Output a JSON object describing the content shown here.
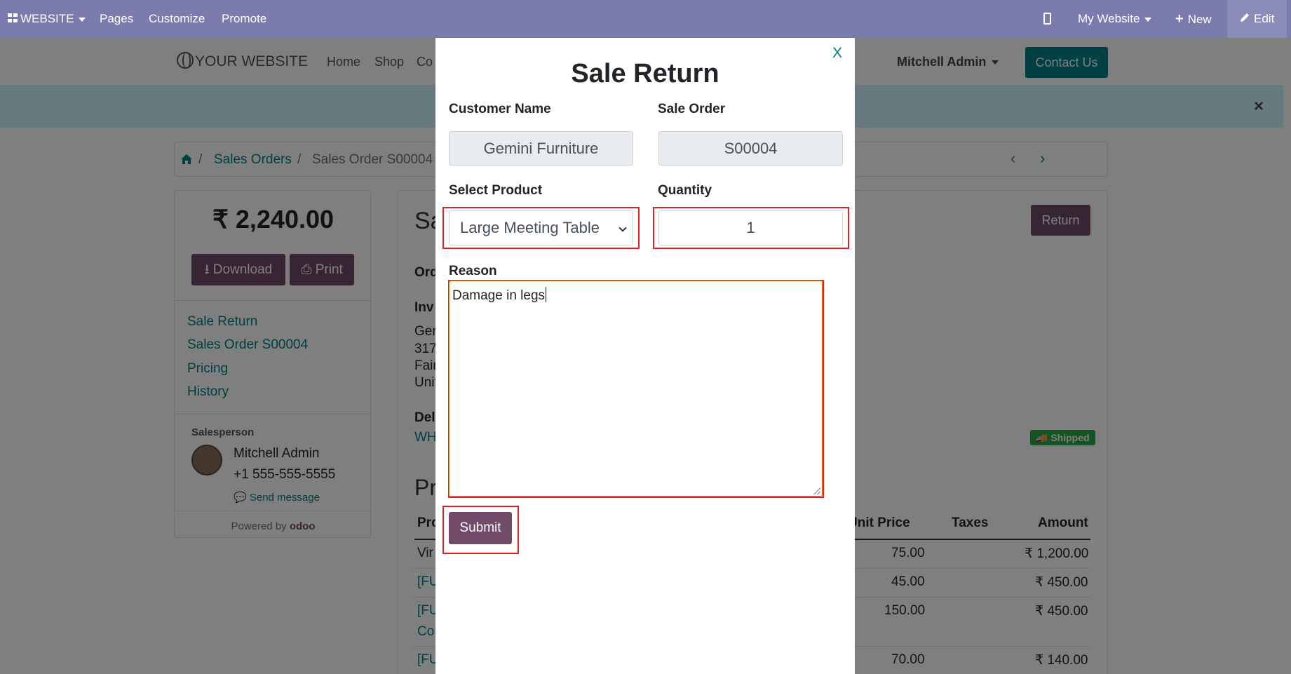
{
  "adminbar": {
    "website": "WEBSITE",
    "pages": "Pages",
    "customize": "Customize",
    "promote": "Promote",
    "my_website": "My Website",
    "new": "New",
    "edit": "Edit"
  },
  "site": {
    "logo": "YOUR WEBSITE",
    "nav": [
      "Home",
      "Shop",
      "Co"
    ],
    "user": "Mitchell Admin",
    "contact": "Contact Us",
    "alert_close": "×"
  },
  "breadcrumb": {
    "sales_orders": "Sales Orders",
    "sep": "/",
    "current": "Sales Order S00004"
  },
  "sidebar": {
    "total": "₹ 2,240.00",
    "download": "Download",
    "print": "Print",
    "links": [
      "Sale Return",
      "Sales Order S00004",
      "Pricing",
      "History"
    ],
    "salesperson_label": "Salesperson",
    "salesperson_name": "Mitchell Admin",
    "salesperson_phone": "+1 555-555-5555",
    "send_message": "Send message",
    "powered_by": "Powered by",
    "brand": "odoo"
  },
  "main": {
    "title_partial": "Sa",
    "return_button": "Return",
    "order_label": "Ord",
    "invoice_label": "Inv",
    "address_lines": [
      "Ger",
      "317",
      "Fair",
      "Unit"
    ],
    "delivery_label": "Deli",
    "delivery_ref": "WH",
    "shipped_badge": "Shipped",
    "products_heading": "Pr",
    "table": {
      "headers": [
        "Pro",
        "Unit Price",
        "Taxes",
        "Amount"
      ],
      "rows": [
        {
          "product": "Vir",
          "unit_price": "75.00",
          "amount": "₹ 1,200.00"
        },
        {
          "product": "[FU",
          "unit_price": "45.00",
          "amount": "₹ 450.00"
        },
        {
          "product": "[FU",
          "product2": "Co",
          "unit_price": "150.00",
          "amount": "₹ 450.00"
        },
        {
          "product": "[FU",
          "unit_price": "70.00",
          "amount": "₹ 140.00"
        }
      ]
    }
  },
  "modal": {
    "close": "X",
    "title": "Sale Return",
    "customer_label": "Customer Name",
    "customer_value": "Gemini Furniture",
    "sale_order_label": "Sale Order",
    "sale_order_value": "S00004",
    "product_label": "Select Product",
    "product_value": "Large Meeting Table",
    "quantity_label": "Quantity",
    "quantity_value": "1",
    "reason_label": "Reason",
    "reason_value": "Damage in legs",
    "submit": "Submit"
  },
  "colors": {
    "adminbar": "#7c7bad",
    "primary": "#714b67",
    "link": "#017e84",
    "highlight": "#e31e24",
    "success": "#28a745"
  }
}
